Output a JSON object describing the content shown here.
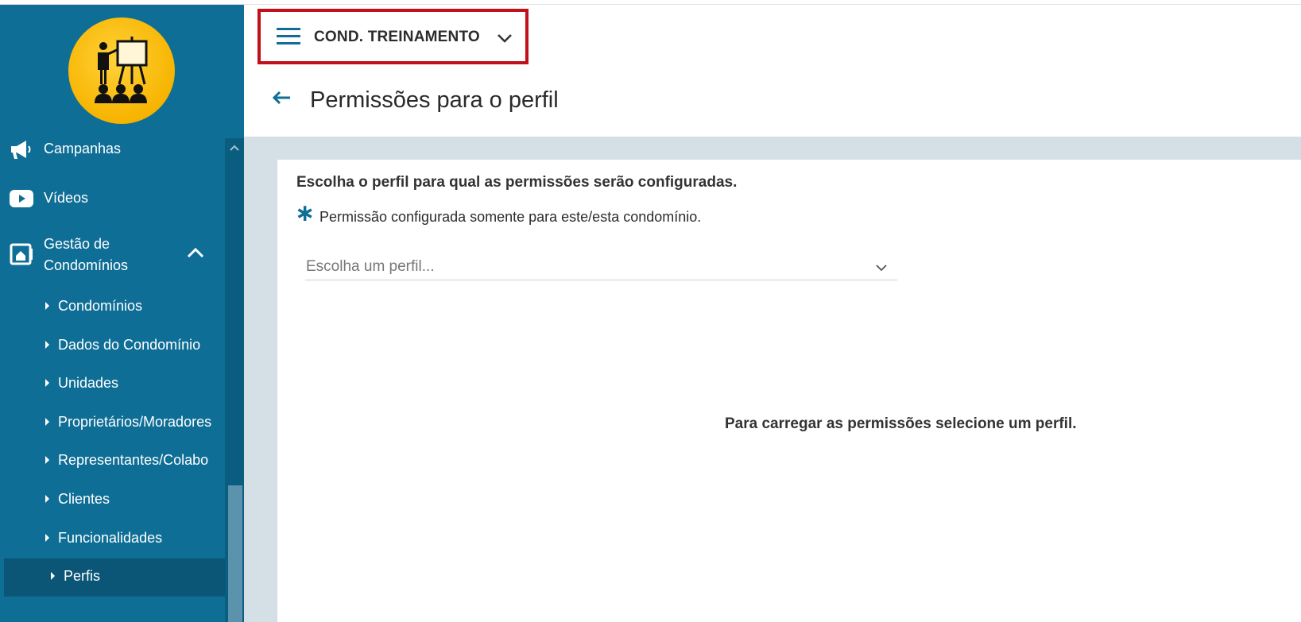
{
  "header": {
    "org_name": "COND. TREINAMENTO",
    "page_title": "Permissões para o perfil"
  },
  "sidebar": {
    "items": [
      {
        "label": "Campanhas",
        "icon": "megaphone-icon"
      },
      {
        "label": "Vídeos",
        "icon": "youtube-icon"
      },
      {
        "label": "Gestão de Condomínios",
        "label_line1": "Gestão de",
        "label_line2": "Condomínios",
        "icon": "building-icon",
        "expanded": true
      }
    ],
    "sub_items": [
      {
        "label": "Condomínios"
      },
      {
        "label": "Dados do Condomínio"
      },
      {
        "label": "Unidades"
      },
      {
        "label": "Proprietários/Moradores"
      },
      {
        "label": "Representantes/Colabo"
      },
      {
        "label": "Clientes"
      },
      {
        "label": "Funcionalidades"
      },
      {
        "label": "Perfis",
        "active": true
      }
    ]
  },
  "content": {
    "heading": "Escolha o perfil para qual as permissões serão configuradas.",
    "asterisk": "∗",
    "note": "Permissão configurada somente para este/esta condomínio.",
    "profile_select_placeholder": "Escolha um perfil...",
    "empty_message": "Para carregar as permissões selecione um perfil."
  },
  "colors": {
    "sidebar_bg": "#0f6e96",
    "accent": "#0f6e96",
    "highlight_border": "#c0111a",
    "content_bg": "#d5dfe6"
  }
}
